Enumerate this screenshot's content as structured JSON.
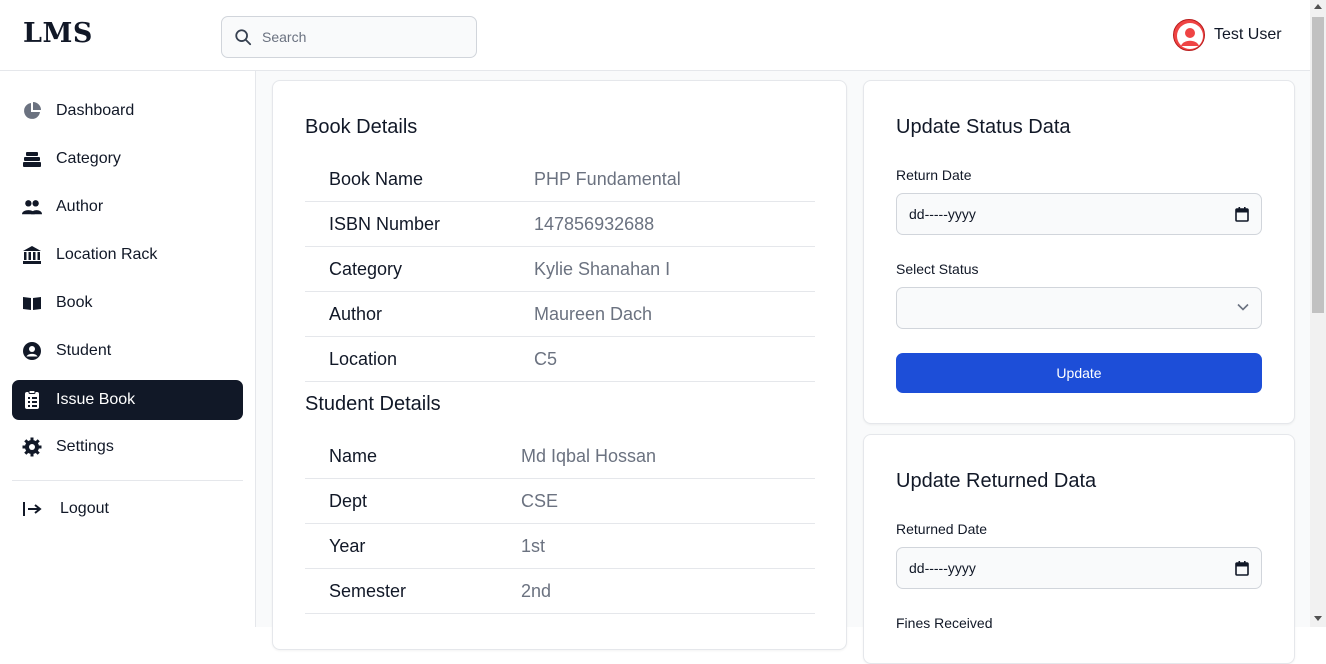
{
  "app": {
    "logo": "LMS"
  },
  "search": {
    "placeholder": "Search"
  },
  "user": {
    "name": "Test User"
  },
  "sidebar": {
    "items": [
      {
        "label": "Dashboard",
        "icon": "pie-chart-icon",
        "active": false
      },
      {
        "label": "Category",
        "icon": "layers-icon",
        "active": false
      },
      {
        "label": "Author",
        "icon": "users-icon",
        "active": false
      },
      {
        "label": "Location Rack",
        "icon": "bank-icon",
        "active": false
      },
      {
        "label": "Book",
        "icon": "book-open-icon",
        "active": false
      },
      {
        "label": "Student",
        "icon": "user-circle-icon",
        "active": false
      },
      {
        "label": "Issue Book",
        "icon": "clipboard-list-icon",
        "active": true
      },
      {
        "label": "Settings",
        "icon": "gear-icon",
        "active": false
      }
    ],
    "logout": "Logout"
  },
  "book_details": {
    "title": "Book Details",
    "rows": [
      {
        "label": "Book Name",
        "value": "PHP Fundamental"
      },
      {
        "label": "ISBN Number",
        "value": "147856932688"
      },
      {
        "label": "Category",
        "value": "Kylie Shanahan I"
      },
      {
        "label": "Author",
        "value": "Maureen Dach"
      },
      {
        "label": "Location",
        "value": "C5"
      }
    ]
  },
  "student_details": {
    "title": "Student Details",
    "rows": [
      {
        "label": "Name",
        "value": "Md Iqbal Hossan"
      },
      {
        "label": "Dept",
        "value": "CSE"
      },
      {
        "label": "Year",
        "value": "1st"
      },
      {
        "label": "Semester",
        "value": "2nd"
      }
    ]
  },
  "update_status": {
    "title": "Update Status Data",
    "return_date_label": "Return Date",
    "return_date_value": "dd-----yyyy",
    "status_label": "Select Status",
    "status_value": "",
    "button": "Update"
  },
  "update_returned": {
    "title": "Update Returned Data",
    "returned_date_label": "Returned Date",
    "returned_date_value": "dd-----yyyy",
    "fines_label": "Fines Received"
  },
  "colors": {
    "accent": "#1d4ed8",
    "active_nav": "#111827",
    "avatar": "#ef4444"
  }
}
